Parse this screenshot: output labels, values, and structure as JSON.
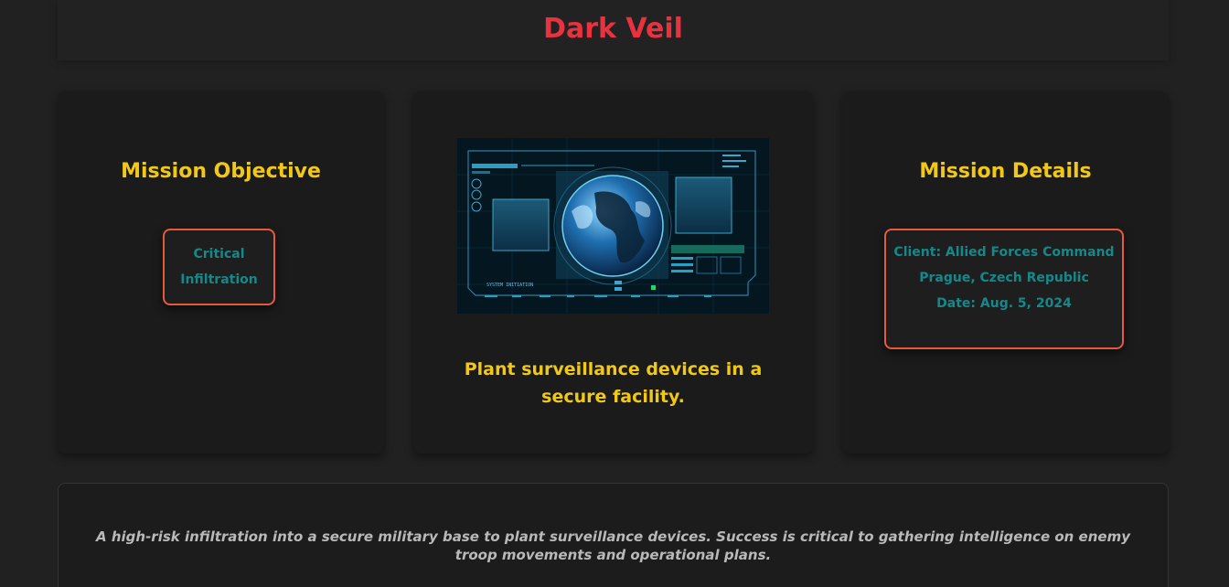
{
  "header": {
    "title": "Dark Veil"
  },
  "objective_card": {
    "title": "Mission Objective",
    "tag": "Critical Infiltration"
  },
  "image_card": {
    "image_icon": "globe-hud-icon",
    "hud_label": "SYSTEM INITIATION",
    "caption": "Plant surveillance devices in a secure facility."
  },
  "details_card": {
    "title": "Mission Details",
    "client": "Client: Allied Forces Command",
    "location": "Prague, Czech Republic",
    "date": "Date: Aug. 5, 2024"
  },
  "summary": {
    "text": "A high-risk infiltration into a secure military base to plant surveillance devices. Success is critical to gathering intelligence on enemy troop movements and operational plans."
  },
  "colors": {
    "title_red": "#e8323f",
    "heading_yellow": "#f2c818",
    "tag_teal": "#15888a",
    "tag_border": "#e45a3f"
  }
}
